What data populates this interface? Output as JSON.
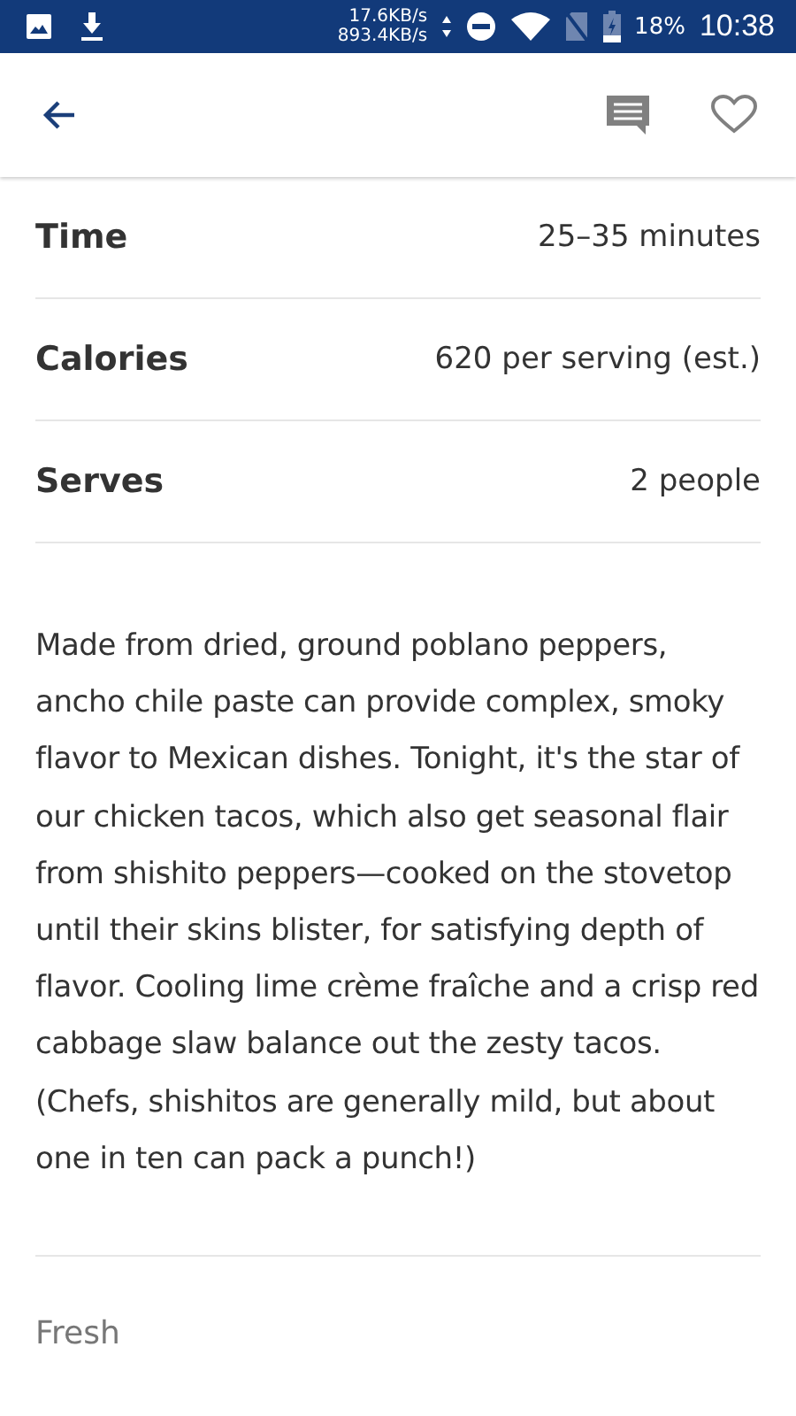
{
  "status_bar": {
    "upload_speed": "17.6KB/s",
    "download_speed": "893.4KB/s",
    "battery": "18%",
    "time": "10:38"
  },
  "details": [
    {
      "label": "Time",
      "value": "25–35 minutes"
    },
    {
      "label": "Calories",
      "value": "620 per serving (est.)"
    },
    {
      "label": "Serves",
      "value": "2 people"
    }
  ],
  "description": "Made from dried, ground poblano peppers, ancho chile paste can provide complex, smoky flavor to Mexican dishes. Tonight, it's the star of our chicken tacos, which also get seasonal flair from shishito peppers—cooked on the stovetop until their skins blister, for satisfying depth of flavor. Cooling lime crème fraîche and a crisp red cabbage slaw balance out the zesty tacos. (Chefs, shishitos are generally mild, but about one in ten can pack a punch!)",
  "section_label": "Fresh"
}
